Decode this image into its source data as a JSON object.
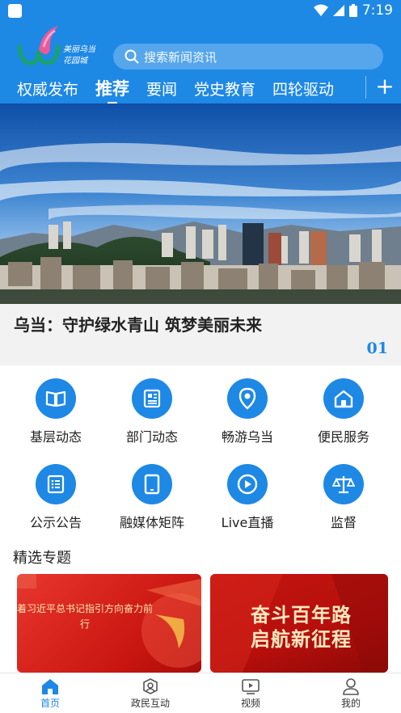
{
  "status": {
    "time": "7:19"
  },
  "search": {
    "placeholder": "搜索新闻资讯"
  },
  "tabs": [
    {
      "label": "权威发布",
      "active": false
    },
    {
      "label": "推荐",
      "active": true
    },
    {
      "label": "要闻",
      "active": false
    },
    {
      "label": "党史教育",
      "active": false
    },
    {
      "label": "四轮驱动",
      "active": false
    }
  ],
  "banner": {
    "headline": "乌当：守护绿水青山 筑梦美丽未来",
    "pager": "01"
  },
  "grid": [
    {
      "label": "基层动态",
      "icon": "book-icon"
    },
    {
      "label": "部门动态",
      "icon": "newspaper-icon"
    },
    {
      "label": "畅游乌当",
      "icon": "location-pin-icon"
    },
    {
      "label": "便民服务",
      "icon": "home-icon"
    },
    {
      "label": "公示公告",
      "icon": "notice-list-icon"
    },
    {
      "label": "融媒体矩阵",
      "icon": "tablet-icon"
    },
    {
      "label": "Live直播",
      "icon": "play-icon"
    },
    {
      "label": "监督",
      "icon": "scale-icon"
    }
  ],
  "section": {
    "title": "精选专题"
  },
  "cards": [
    {
      "text": "着习近平总书记指引方向奋力前行"
    },
    {
      "line1": "奋斗百年路",
      "line2": "启航新征程"
    }
  ],
  "bottom_nav": [
    {
      "label": "首页",
      "active": true,
      "icon": "home-icon"
    },
    {
      "label": "政民互动",
      "active": false,
      "icon": "interaction-icon"
    },
    {
      "label": "视频",
      "active": false,
      "icon": "video-icon"
    },
    {
      "label": "我的",
      "active": false,
      "icon": "profile-icon"
    }
  ],
  "colors": {
    "primary": "#1e88e5",
    "card_red": "#c8150f",
    "active_nav": "#1e88e5"
  }
}
